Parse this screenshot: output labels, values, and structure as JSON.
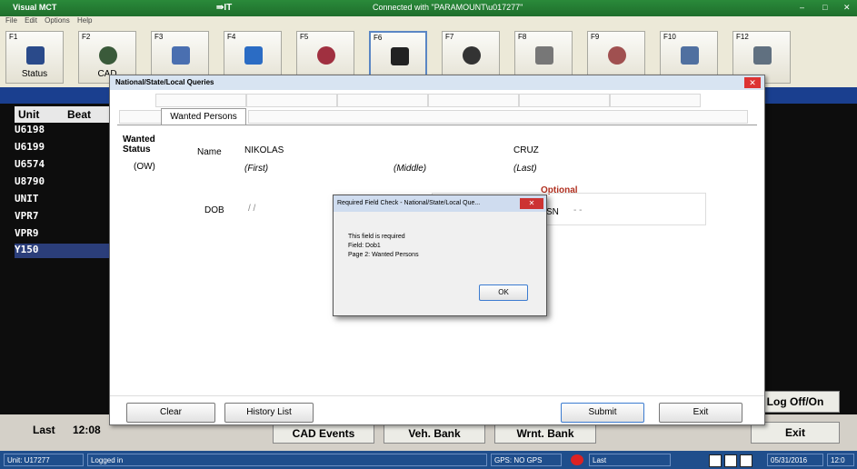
{
  "app": {
    "title": "Visual MCT",
    "connection": "Connected with \"PARAMOUNT\\u017277\"",
    "menu": [
      "File",
      "Edit",
      "Options",
      "Help"
    ]
  },
  "toolbar": {
    "keys": [
      {
        "num": "F1",
        "label": "Status",
        "icon": "help-icon",
        "color": "#2a4a8a"
      },
      {
        "num": "F2",
        "label": "CAD",
        "icon": "people-icon",
        "color": "#3a5a3a"
      },
      {
        "num": "F3",
        "label": "",
        "icon": "document-arrow-icon",
        "color": "#4a6fb0"
      },
      {
        "num": "F4",
        "label": "",
        "icon": "monitor-icon",
        "color": "#2b6cc4"
      },
      {
        "num": "F5",
        "label": "",
        "icon": "hazard-icon",
        "color": "#a03040"
      },
      {
        "num": "F6",
        "label": "",
        "icon": "binoculars-icon",
        "color": "#222222"
      },
      {
        "num": "F7",
        "label": "",
        "icon": "car-icon",
        "color": "#333333"
      },
      {
        "num": "F8",
        "label": "",
        "icon": "gun-icon",
        "color": "#777777"
      },
      {
        "num": "F9",
        "label": "",
        "icon": "person-icon",
        "color": "#a05050"
      },
      {
        "num": "F10",
        "label": "",
        "icon": "id-card-icon",
        "color": "#5070a0"
      },
      {
        "num": "F12",
        "label": "",
        "icon": "notepad-icon",
        "color": "#607080"
      }
    ]
  },
  "units": {
    "header_unit": "Unit",
    "header_beat": "Beat",
    "rows": [
      "U6198",
      "U6199",
      "U6574",
      "U8790",
      "UNIT",
      "VPR7",
      "VPR9",
      "Y150"
    ]
  },
  "bottom": {
    "last_label": "Last",
    "last_time": "12:08",
    "cad_events": "CAD Events",
    "veh_bank": "Veh. Bank",
    "wrnt_bank": "Wrnt. Bank",
    "log_off_on": "Log Off/On",
    "exit": "Exit"
  },
  "statusbar": {
    "unit": "Unit: U17277",
    "logged": "Logged in",
    "gps": "GPS: NO GPS",
    "last": "Last",
    "date": "05/31/2016",
    "time": "12:0"
  },
  "dialog": {
    "title": "National/State/Local Queries",
    "active_tab": "Wanted Persons",
    "wanted_status_label": "Wanted Status",
    "wanted_status_value": "(OW)",
    "name_label": "Name",
    "first_value": "NIKOLAS",
    "last_value": "CRUZ",
    "first_label": "(First)",
    "middle_label": "(Middle)",
    "last_label": "(Last)",
    "dob_label": "DOB",
    "dob_value": "/ /",
    "optional_label": "Optional",
    "ssn_label": "SN",
    "ssn_value": "- -",
    "clear_btn": "Clear",
    "history_btn": "History List",
    "submit_btn": "Submit",
    "exit_btn": "Exit"
  },
  "popup": {
    "title": "Required Field Check - National/State/Local Que...",
    "line1": "This field is required",
    "line2": "Field: Dob1",
    "line3": "Page 2: Wanted Persons",
    "ok": "OK"
  }
}
